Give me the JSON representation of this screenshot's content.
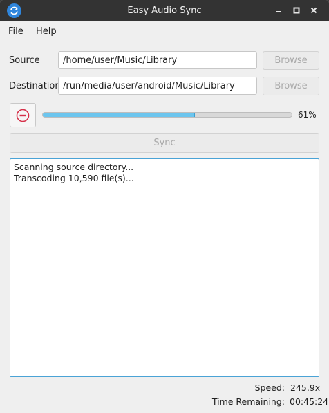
{
  "window": {
    "title": "Easy Audio Sync"
  },
  "menu": {
    "items": [
      "File",
      "Help"
    ]
  },
  "form": {
    "source_label": "Source",
    "source_value": "/home/user/Music/Library",
    "destination_label": "Destination",
    "destination_value": "/run/media/user/android/Music/Library",
    "browse_label": "Browse"
  },
  "progress": {
    "value": 0.61,
    "text": "61%"
  },
  "sync_label": "Sync",
  "log": {
    "lines": [
      "Scanning source directory...",
      "Transcoding 10,590 file(s)..."
    ]
  },
  "status": {
    "speed_label": "Speed:",
    "speed_value": "245.9x",
    "time_label": "Time Remaining:",
    "time_value": "00:45:24"
  },
  "colors": {
    "accent": "#6cc5ee",
    "stop": "#d6314a",
    "app_icon": "#2f86dd",
    "titlebar": "#333333"
  }
}
